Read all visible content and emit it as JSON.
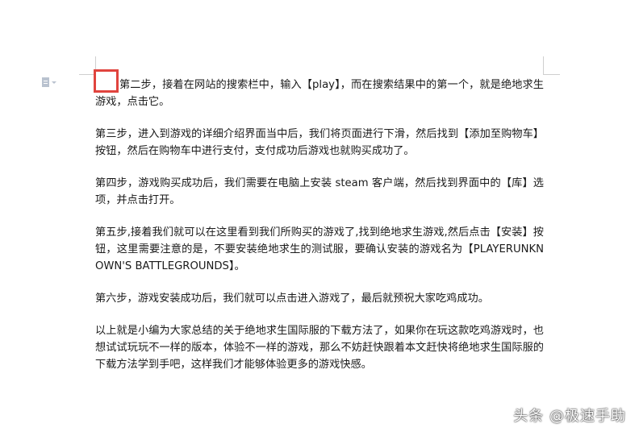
{
  "document": {
    "paragraphs": [
      "第二步，接着在网站的搜索栏中，输入【play】，而在搜索结果中的第一个，就是绝地求生游戏，点击它。",
      "第三步，进入到游戏的详细介绍界面当中后，我们将页面进行下滑，然后找到【添加至购物车】按钮，然后在购物车中进行支付，支付成功后游戏也就购买成功了。",
      "第四步，游戏购买成功后，我们需要在电脑上安装 steam 客户端，然后找到界面中的【库】选项，并点击打开。",
      "第五步,接着我们就可以在这里看到我们所购买的游戏了,找到绝地求生游戏,然后点击【安装】按钮，这里需要注意的是，不要安装绝地求生的测试服，要确认安装的游戏名为【PLAYERUNKNOWN'S BATTLEGROUNDS】。",
      "第六步，游戏安装成功后，我们就可以点击进入游戏了，最后就预祝大家吃鸡成功。",
      "以上就是小编为大家总结的关于绝地求生国际服的下载方法了，如果你在玩这款吃鸡游戏时，也想试试玩玩不一样的版本，体验不一样的游戏，那么不妨赶快跟着本文赶快将绝地求生国际服的下载方法学到手吧，这样我们才能够体验更多的游戏快感。"
    ]
  },
  "watermark": "头条 @极速手助",
  "icons": {
    "doc_icon": "document-icon",
    "highlight_color": "#e0443e"
  }
}
